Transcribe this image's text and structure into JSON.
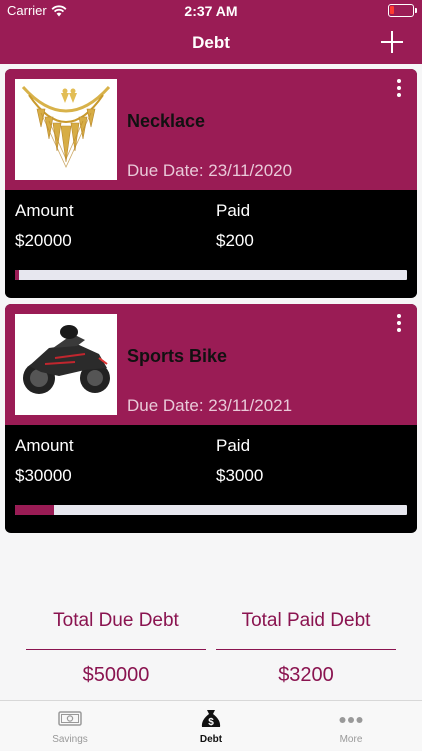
{
  "status_bar": {
    "carrier": "Carrier",
    "time": "2:37 AM"
  },
  "nav": {
    "title": "Debt"
  },
  "debts": [
    {
      "name": "Necklace",
      "due_date": "Due Date: 23/11/2020",
      "amount_label": "Amount",
      "amount": "$20000",
      "paid_label": "Paid",
      "paid": "$200",
      "progress": 0.01
    },
    {
      "name": "Sports Bike",
      "due_date": "Due Date: 23/11/2021",
      "amount_label": "Amount",
      "amount": "$30000",
      "paid_label": "Paid",
      "paid": "$3000",
      "progress": 0.1
    }
  ],
  "totals": {
    "due_label": "Total Due Debt",
    "due_value": "$50000",
    "paid_label": "Total Paid Debt",
    "paid_value": "$3200"
  },
  "tabs": [
    {
      "label": "Savings",
      "icon": "banknote-icon"
    },
    {
      "label": "Debt",
      "icon": "money-bag-icon"
    },
    {
      "label": "More",
      "icon": "more-dots-icon"
    }
  ],
  "colors": {
    "accent": "#9a1c55",
    "accent_text": "#8a1450",
    "card_dark": "#000000"
  }
}
